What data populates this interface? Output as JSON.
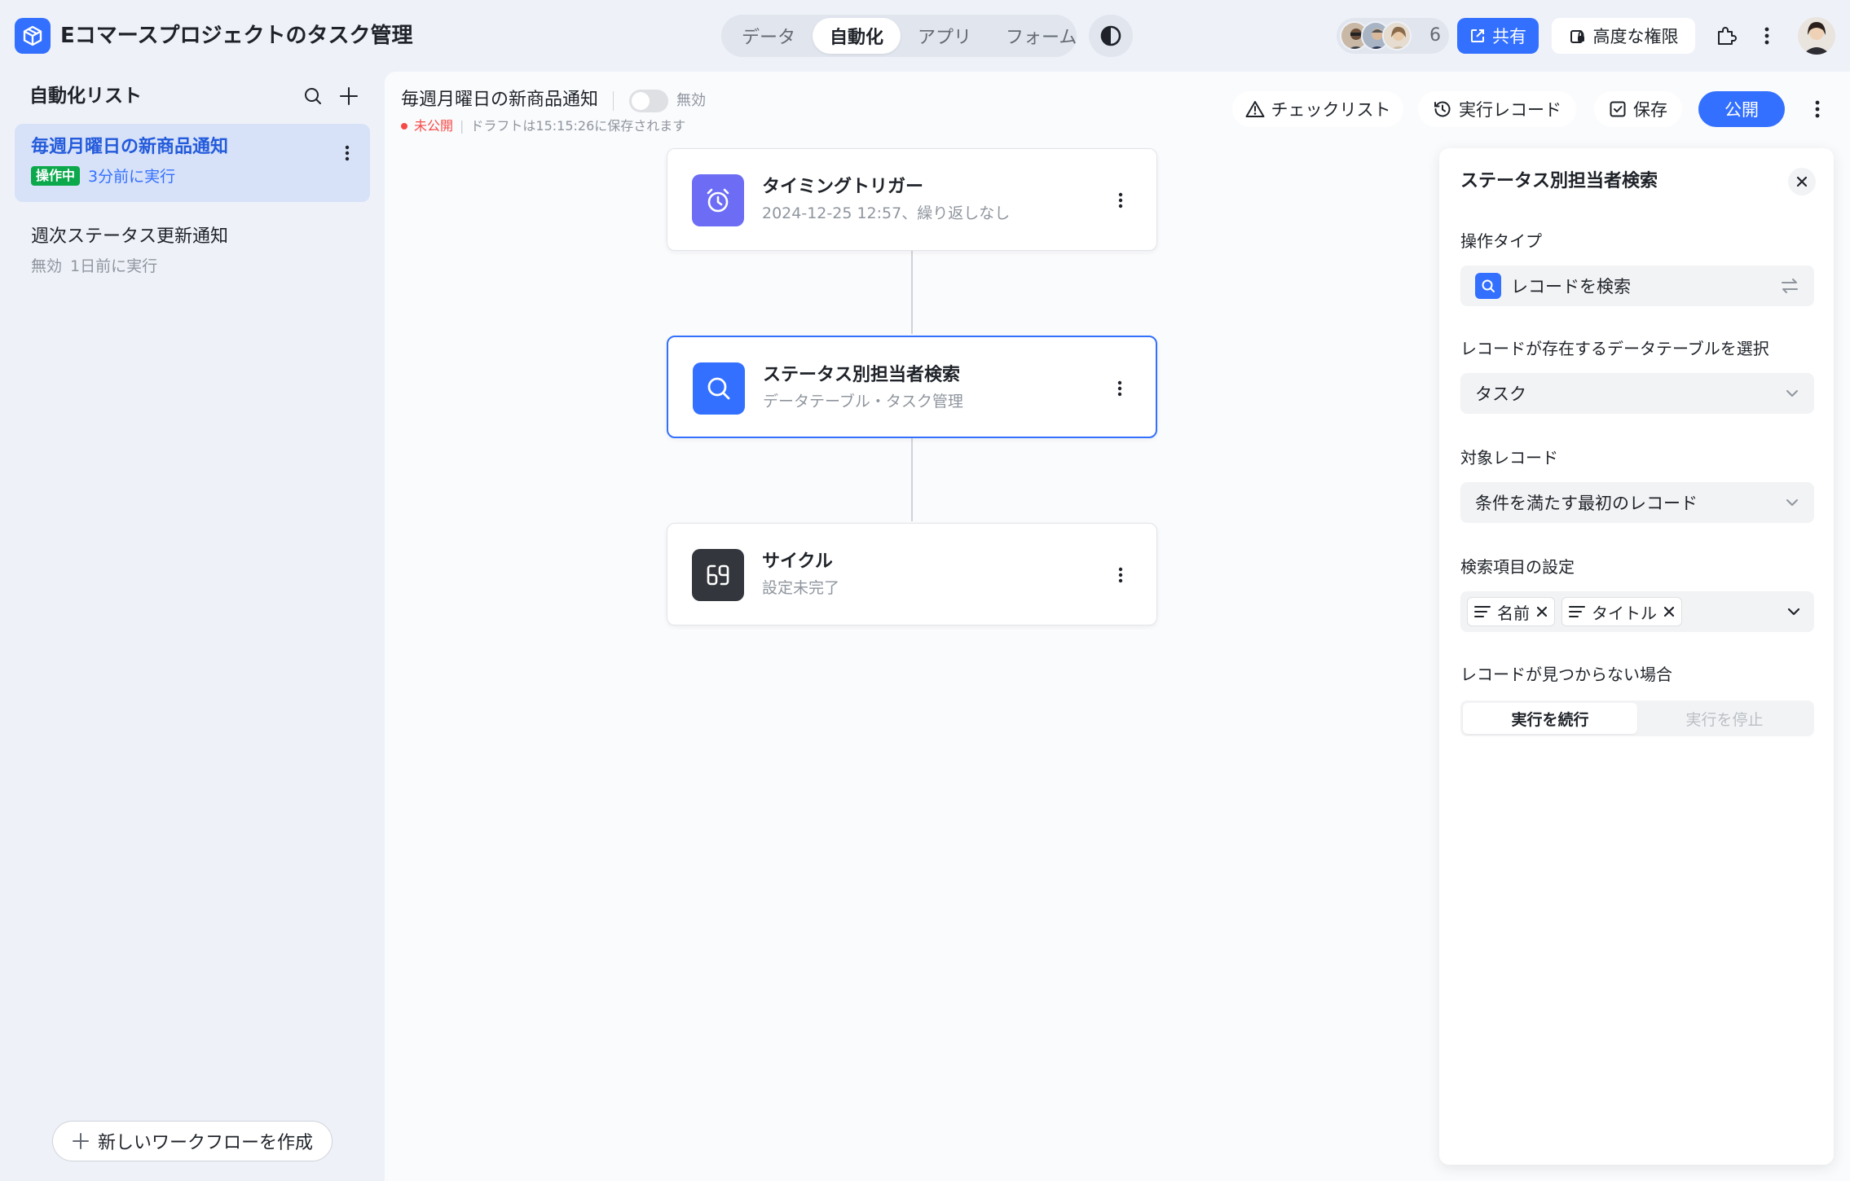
{
  "colors": {
    "accent": "#3370ff",
    "background": "#eef1f8",
    "canvas": "#fafbfd",
    "active_badge": "#0ca84c",
    "unpublished": "#f54a45",
    "trigger_icon_bg": "#6c6cf5",
    "search_icon_bg": "#3370ff",
    "cycle_icon_bg": "#33373d"
  },
  "header": {
    "app_title": "Eコマースプロジェクトのタスク管理",
    "tabs": [
      {
        "label": "データ",
        "active": false
      },
      {
        "label": "自動化",
        "active": true
      },
      {
        "label": "アプリ",
        "active": false
      },
      {
        "label": "フォーム",
        "active": false
      }
    ],
    "collaborator_count": "6",
    "share_label": "共有",
    "permissions_label": "高度な権限"
  },
  "sidebar": {
    "title": "自動化リスト",
    "items": [
      {
        "name": "毎週月曜日の新商品通知",
        "status": "操作中",
        "meta": "3分前に実行",
        "active": true
      },
      {
        "name": "週次ステータス更新通知",
        "status": "無効",
        "meta": "1日前に実行",
        "active": false
      }
    ],
    "new_workflow_label": "新しいワークフローを作成"
  },
  "workflow": {
    "title": "毎週月曜日の新商品通知",
    "toggle_label": "無効",
    "toggle_on": false,
    "publish_status": "未公開",
    "draft_info": "ドラフトは15:15:26に保存されます",
    "toolbar": {
      "checklist": "チェックリスト",
      "run_records": "実行レコード",
      "save": "保存",
      "publish": "公開"
    },
    "nodes": [
      {
        "title": "タイミングトリガー",
        "subtitle": "2024-12-25 12:57、繰り返しなし",
        "icon": "alarm-clock-icon",
        "selected": false
      },
      {
        "title": "ステータス別担当者検索",
        "subtitle": "データテーブル・タスク管理",
        "icon": "search-icon",
        "selected": true
      },
      {
        "title": "サイクル",
        "subtitle": "設定未完了",
        "icon": "loop-icon",
        "selected": false
      }
    ]
  },
  "panel": {
    "title": "ステータス別担当者検索",
    "operation_type_label": "操作タイプ",
    "operation_type_value": "レコードを検索",
    "table_label": "レコードが存在するデータテーブルを選択",
    "table_value": "タスク",
    "target_label": "対象レコード",
    "target_value": "条件を満たす最初のレコード",
    "search_fields_label": "検索項目の設定",
    "search_fields": [
      "名前",
      "タイトル"
    ],
    "not_found_label": "レコードが見つからない場合",
    "not_found_options": [
      {
        "label": "実行を続行",
        "active": true
      },
      {
        "label": "実行を停止",
        "active": false
      }
    ]
  }
}
